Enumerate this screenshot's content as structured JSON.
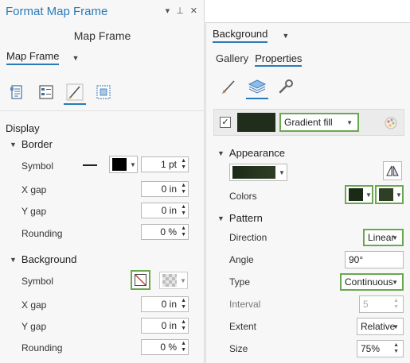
{
  "left": {
    "title": "Format Map Frame",
    "ctrl_menu": "▾",
    "ctrl_pin": "⊥",
    "ctrl_close": "✕",
    "subtitle": "Map Frame",
    "element": "Map Frame",
    "section": "Display",
    "border": {
      "heading": "Border",
      "symbol_label": "Symbol",
      "symbol_width": "1 pt",
      "x_gap_label": "X gap",
      "x_gap": "0 in",
      "y_gap_label": "Y gap",
      "y_gap": "0 in",
      "rounding_label": "Rounding",
      "rounding": "0 %"
    },
    "background": {
      "heading": "Background",
      "symbol_label": "Symbol",
      "x_gap_label": "X gap",
      "x_gap": "0 in",
      "y_gap_label": "Y gap",
      "y_gap": "0 in",
      "rounding_label": "Rounding",
      "rounding": "0 %"
    }
  },
  "right": {
    "element": "Background",
    "tabs": [
      "Gallery",
      "Properties"
    ],
    "symbol_type": "Gradient fill",
    "appearance": {
      "heading": "Appearance",
      "colors_label": "Colors"
    },
    "pattern": {
      "heading": "Pattern",
      "direction_label": "Direction",
      "direction": "Linear",
      "angle_label": "Angle",
      "angle": "90°",
      "type_label": "Type",
      "type": "Continuous",
      "interval_label": "Interval",
      "interval": "5",
      "extent_label": "Extent",
      "extent": "Relative",
      "size_label": "Size",
      "size": "75%"
    }
  },
  "colors": {
    "accent": "#2a7ab8",
    "highlight": "#6aa84f",
    "gradient_dark": "#1b2a16",
    "gradient_light": "#2f3f26"
  }
}
